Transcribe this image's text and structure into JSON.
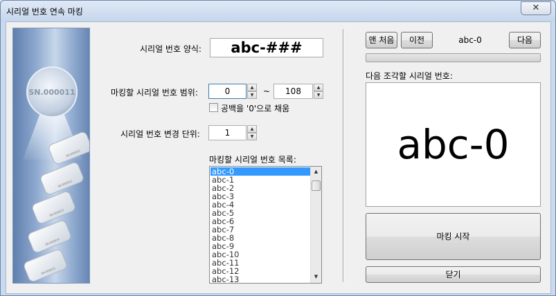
{
  "window": {
    "title": "시리얼 번호 연속 마킹",
    "close_glyph": "✕"
  },
  "side_image": {
    "badge": "SN.000011",
    "cards": [
      "SN.000011",
      "SN.000012",
      "SN.000013",
      "SN.000014",
      "SN.000015"
    ]
  },
  "left": {
    "format_label": "시리얼 번호 양식:",
    "format_value": "abc-###",
    "range_label": "마킹할 시리얼 번호 범위:",
    "range_from": "0",
    "range_sep": "~",
    "range_to": "108",
    "pad_zero_label": "공백을 '0'으로 채움",
    "pad_zero_checked": false,
    "step_label": "시리얼 번호 변경 단위:",
    "step_value": "1",
    "list_label": "마킹할 시리얼 번호 목록:",
    "list_items": [
      "abc-0",
      "abc-1",
      "abc-2",
      "abc-3",
      "abc-4",
      "abc-5",
      "abc-6",
      "abc-7",
      "abc-8",
      "abc-9",
      "abc-10",
      "abc-11",
      "abc-12",
      "abc-13"
    ],
    "selected_index": 0
  },
  "right": {
    "first_label": "맨 처음",
    "prev_label": "이전",
    "current": "abc-0",
    "next_label": "다음",
    "progress_fraction": 0,
    "next_piece_label": "다음 조각할 시리얼 번호:",
    "preview_value": "abc-0",
    "start_label": "마킹 시작",
    "close_label": "닫기"
  },
  "icons": {
    "spin_up": "▲",
    "spin_down": "▼",
    "scroll_up": "▲",
    "scroll_down": "▼"
  }
}
